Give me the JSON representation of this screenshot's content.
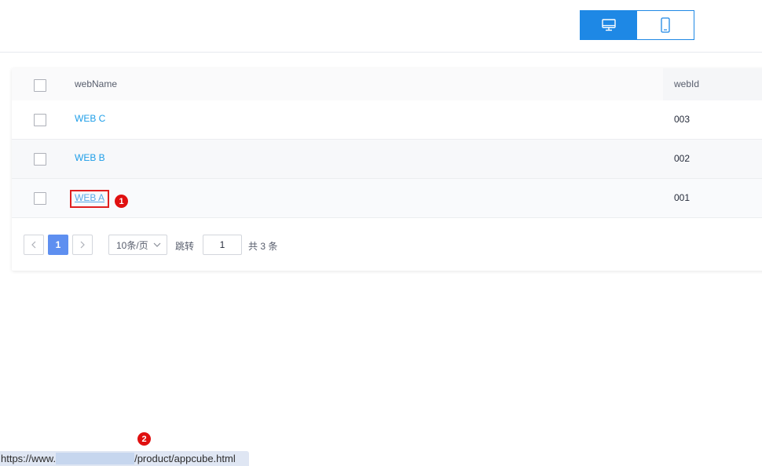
{
  "view_toggle": {
    "desktop_icon": "monitor-icon",
    "mobile_icon": "phone-icon",
    "active": "desktop"
  },
  "table": {
    "columns": [
      "webName",
      "webId"
    ],
    "rows": [
      {
        "webName": "WEB C",
        "webId": "003"
      },
      {
        "webName": "WEB B",
        "webId": "002"
      },
      {
        "webName": "WEB A",
        "webId": "001"
      }
    ]
  },
  "pagination": {
    "current_page": "1",
    "page_size": "10条/页",
    "jump_label": "跳转",
    "jump_value": "1",
    "total": "共 3 条"
  },
  "annotations": {
    "step1": "1",
    "step2": "2"
  },
  "status_bar": {
    "url_prefix": "https://www.",
    "url_suffix": "/product/appcube.html"
  },
  "colors": {
    "accent": "#1e88e5",
    "link": "#1e9ee8",
    "highlight": "#e02020",
    "page_active": "#5e8ff0"
  }
}
